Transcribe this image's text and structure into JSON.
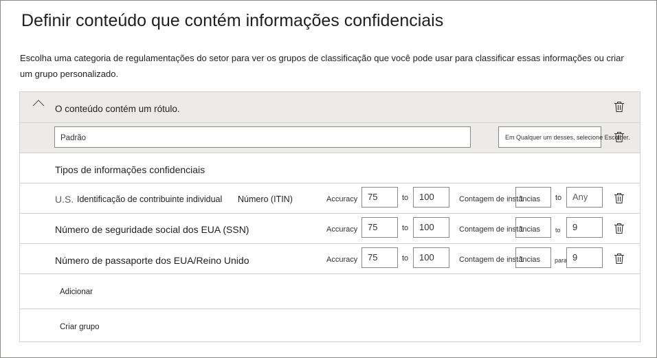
{
  "header": {
    "title": "Definir conteúdo que contém informações confidenciais",
    "description": "Escolha uma categoria de regulamentações do setor para ver os grupos de classificação que você pode usar para classificar essas informações ou criar um grupo personalizado."
  },
  "group": {
    "label": "O conteúdo contém um rótulo.",
    "name_value": "Padrão",
    "operator_value": "Em Qualquer um desses, selecione Escolher."
  },
  "section_title": "Tipos de informações confidenciais",
  "rows": [
    {
      "name_part1": "U.S.",
      "name_part2": "Identificação de contribuinte individual",
      "name_part3": "Número (ITIN)",
      "accuracy_label": "Accuracy",
      "acc_min": "75",
      "to1": "to",
      "acc_max": "100",
      "count_label": "Contagem de instâncias",
      "count_min": "1",
      "to2": "to",
      "count_max": "Any"
    },
    {
      "name": "Número de seguridade social dos EUA (SSN)",
      "accuracy_label": "Accuracy",
      "acc_min": "75",
      "to1": "to",
      "acc_max": "100",
      "count_label": "Contagem de instâncias",
      "count_min": "1",
      "to2": "to",
      "count_max": "9"
    },
    {
      "name": "Número de passaporte dos EUA/Reino Unido",
      "accuracy_label": "Accuracy",
      "acc_min": "75",
      "to1": "to",
      "acc_max": "100",
      "count_label": "Contagem de instâncias",
      "count_min": "1",
      "to2": "para",
      "count_max": "9"
    }
  ],
  "actions": {
    "add": "Adicionar",
    "create_group": "Criar grupo"
  }
}
